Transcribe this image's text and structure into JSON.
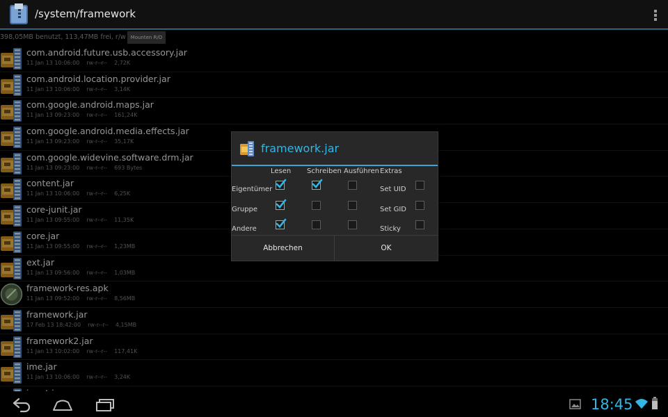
{
  "header": {
    "path": "/system/framework",
    "menu_icon": "overflow-menu-icon"
  },
  "storage": {
    "info": "398,05MB benutzt, 113,47MB frei, r/w",
    "mount_button": "Mounten R/O"
  },
  "files": [
    {
      "name": "com.android.future.usb.accessory.jar",
      "date": "11 Jan 13 10:06:00",
      "perms": "rw-r--r--",
      "size": "2,72K",
      "icon": "jar-archive-icon"
    },
    {
      "name": "com.android.location.provider.jar",
      "date": "11 Jan 13 10:06:00",
      "perms": "rw-r--r--",
      "size": "3,14K",
      "icon": "jar-archive-icon"
    },
    {
      "name": "com.google.android.maps.jar",
      "date": "11 Jan 13 09:23:00",
      "perms": "rw-r--r--",
      "size": "161,24K",
      "icon": "jar-archive-icon"
    },
    {
      "name": "com.google.android.media.effects.jar",
      "date": "11 Jan 13 09:23:00",
      "perms": "rw-r--r--",
      "size": "35,17K",
      "icon": "jar-archive-icon"
    },
    {
      "name": "com.google.widevine.software.drm.jar",
      "date": "11 Jan 13 09:23:00",
      "perms": "rw-r--r--",
      "size": "693 Bytes",
      "icon": "jar-archive-icon"
    },
    {
      "name": "content.jar",
      "date": "11 Jan 13 10:06:00",
      "perms": "rw-r--r--",
      "size": "6,25K",
      "icon": "jar-archive-icon"
    },
    {
      "name": "core-junit.jar",
      "date": "11 Jan 13 09:55:00",
      "perms": "rw-r--r--",
      "size": "11,35K",
      "icon": "jar-archive-icon"
    },
    {
      "name": "core.jar",
      "date": "11 Jan 13 09:55:00",
      "perms": "rw-r--r--",
      "size": "1,23MB",
      "icon": "jar-archive-icon"
    },
    {
      "name": "ext.jar",
      "date": "11 Jan 13 09:56:00",
      "perms": "rw-r--r--",
      "size": "1,03MB",
      "icon": "jar-archive-icon"
    },
    {
      "name": "framework-res.apk",
      "date": "11 Jan 13 09:52:00",
      "perms": "rw-r--r--",
      "size": "8,56MB",
      "icon": "apk-package-icon"
    },
    {
      "name": "framework.jar",
      "date": "17 Feb 13 18:42:00",
      "perms": "rw-r--r--",
      "size": "4,15MB",
      "icon": "jar-archive-icon"
    },
    {
      "name": "framework2.jar",
      "date": "11 Jan 13 10:02:00",
      "perms": "rw-r--r--",
      "size": "117,41K",
      "icon": "jar-archive-icon"
    },
    {
      "name": "ime.jar",
      "date": "11 Jan 13 10:06:00",
      "perms": "rw-r--r--",
      "size": "3,24K",
      "icon": "jar-archive-icon"
    },
    {
      "name": "input.jar",
      "date": "",
      "perms": "",
      "size": "",
      "icon": "jar-archive-icon"
    }
  ],
  "dialog": {
    "title": "framework.jar",
    "columns": [
      "Lesen",
      "Schreiben",
      "Ausführen",
      "Extras"
    ],
    "rows": [
      {
        "label": "Eigentümer",
        "read": true,
        "write": true,
        "exec": false,
        "extra_label": "Set UID",
        "extra": false
      },
      {
        "label": "Gruppe",
        "read": true,
        "write": false,
        "exec": false,
        "extra_label": "Set GID",
        "extra": false
      },
      {
        "label": "Andere",
        "read": true,
        "write": false,
        "exec": false,
        "extra_label": "Sticky",
        "extra": false
      }
    ],
    "cancel_label": "Abbrechen",
    "ok_label": "OK"
  },
  "navbar": {
    "back_icon": "back-icon",
    "home_icon": "home-icon",
    "recents_icon": "recent-apps-icon"
  },
  "status": {
    "time": "18:45",
    "accent_color": "#33b5e5"
  }
}
